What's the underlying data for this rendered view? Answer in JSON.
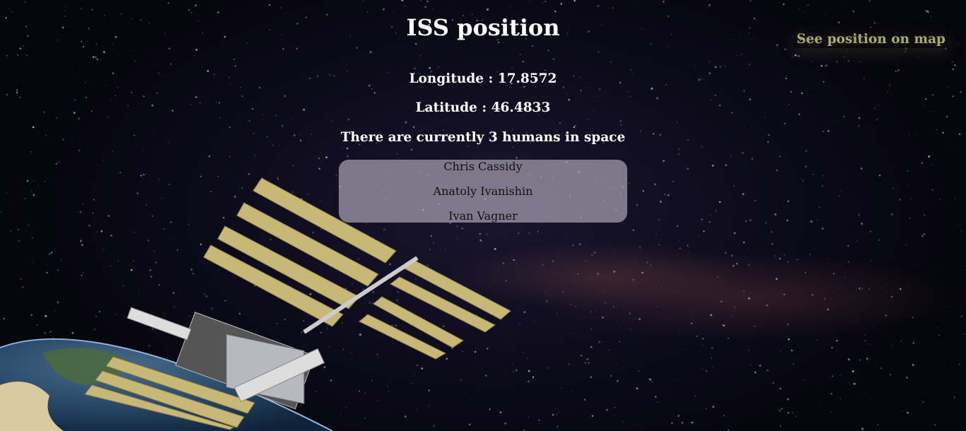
{
  "header": {
    "title": "ISS position",
    "map_link": "See position on map"
  },
  "position": {
    "longitude_label": "Longitude : 17.8572",
    "latitude_label": "Latitude : 46.4833",
    "longitude": 17.8572,
    "latitude": 46.4833
  },
  "crew": {
    "summary": "There are currently 3 humans in space",
    "count": 3,
    "names": [
      "Chris Cassidy",
      "Anatoly Ivanishin",
      "Ivan Vagner"
    ]
  },
  "colors": {
    "link": "#a9ab6e",
    "panel": "#c8b878",
    "crew_box": "#afaab9"
  }
}
